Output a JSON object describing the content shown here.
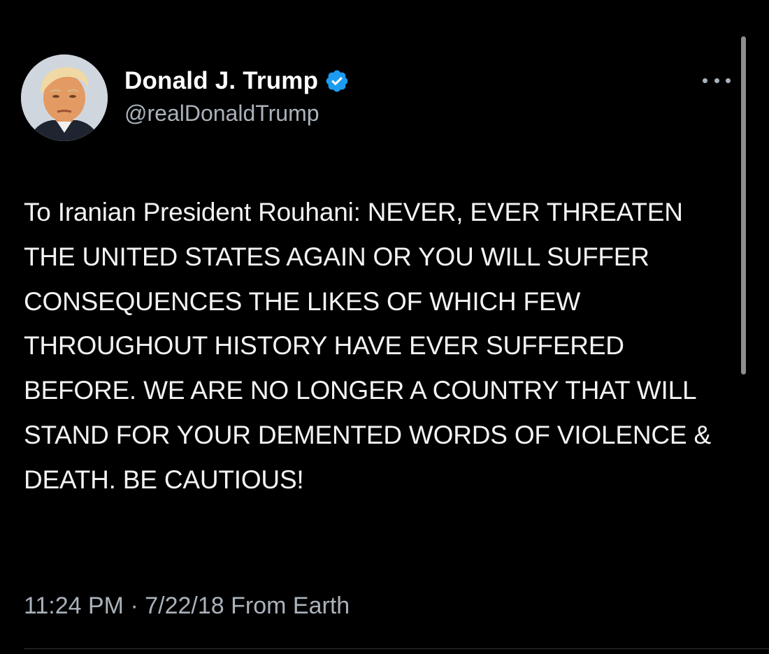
{
  "tweet": {
    "author": {
      "display_name": "Donald J. Trump",
      "handle": "@realDonaldTrump",
      "verified": true,
      "verified_color": "#1d9bf0"
    },
    "more_icon": "more-horizontal-icon",
    "text": "To Iranian President Rouhani: NEVER, EVER THREATEN THE UNITED STATES AGAIN OR YOU WILL SUFFER CONSEQUENCES THE LIKES OF WHICH FEW THROUGHOUT HISTORY HAVE EVER SUFFERED BEFORE. WE ARE NO LONGER A COUNTRY THAT WILL STAND FOR YOUR DEMENTED WORDS OF VIOLENCE & DEATH. BE CAUTIOUS!",
    "time": "11:24 PM",
    "separator": " · ",
    "date": "7/22/18",
    "source": "From Earth"
  },
  "colors": {
    "background": "#000000",
    "primary_text": "#e7e9ea",
    "secondary_text": "#71767b",
    "accent": "#1d9bf0"
  }
}
